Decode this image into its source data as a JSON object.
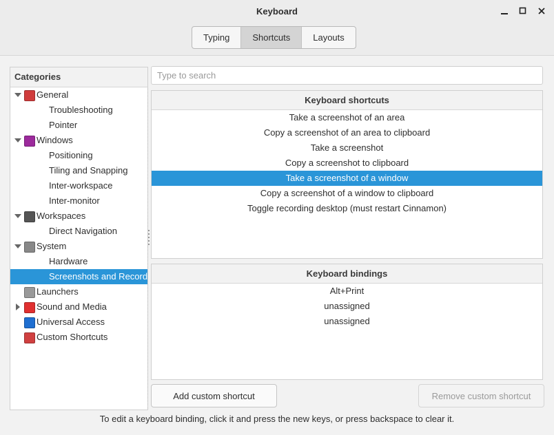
{
  "window": {
    "title": "Keyboard",
    "minimize_glyph": "–",
    "maximize_glyph": "□",
    "close_glyph": "×"
  },
  "tabs": [
    {
      "label": "Typing",
      "active": false
    },
    {
      "label": "Shortcuts",
      "active": true
    },
    {
      "label": "Layouts",
      "active": false
    }
  ],
  "categories": {
    "header": "Categories",
    "items": [
      {
        "label": "General",
        "level": 0,
        "expanded": true,
        "icon": "general-icon",
        "icon_color": "#d03c3c"
      },
      {
        "label": "Troubleshooting",
        "level": 1
      },
      {
        "label": "Pointer",
        "level": 1
      },
      {
        "label": "Windows",
        "level": 0,
        "expanded": true,
        "icon": "windows-icon",
        "icon_color": "#9c2a9c"
      },
      {
        "label": "Positioning",
        "level": 1
      },
      {
        "label": "Tiling and Snapping",
        "level": 1
      },
      {
        "label": "Inter-workspace",
        "level": 1
      },
      {
        "label": "Inter-monitor",
        "level": 1
      },
      {
        "label": "Workspaces",
        "level": 0,
        "expanded": true,
        "icon": "workspaces-icon",
        "icon_color": "#555555"
      },
      {
        "label": "Direct Navigation",
        "level": 1
      },
      {
        "label": "System",
        "level": 0,
        "expanded": true,
        "icon": "system-icon",
        "icon_color": "#888888"
      },
      {
        "label": "Hardware",
        "level": 1
      },
      {
        "label": "Screenshots and Recording",
        "level": 1,
        "selected": true
      },
      {
        "label": "Launchers",
        "level": 0,
        "icon": "launchers-icon",
        "icon_color": "#999999"
      },
      {
        "label": "Sound and Media",
        "level": 0,
        "expanded": false,
        "icon": "sound-media-icon",
        "icon_color": "#e03030"
      },
      {
        "label": "Universal Access",
        "level": 0,
        "icon": "universal-access-icon",
        "icon_color": "#1f6fd1"
      },
      {
        "label": "Custom Shortcuts",
        "level": 0,
        "icon": "custom-shortcuts-icon",
        "icon_color": "#d04040"
      }
    ]
  },
  "search": {
    "placeholder": "Type to search",
    "value": ""
  },
  "shortcuts": {
    "header": "Keyboard shortcuts",
    "items": [
      {
        "label": "Take a screenshot of an area"
      },
      {
        "label": "Copy a screenshot of an area to clipboard"
      },
      {
        "label": "Take a screenshot"
      },
      {
        "label": "Copy a screenshot to clipboard"
      },
      {
        "label": "Take a screenshot of a window",
        "selected": true
      },
      {
        "label": "Copy a screenshot of a window to clipboard"
      },
      {
        "label": "Toggle recording desktop (must restart Cinnamon)"
      }
    ]
  },
  "bindings": {
    "header": "Keyboard bindings",
    "items": [
      "Alt+Print",
      "unassigned",
      "unassigned"
    ]
  },
  "buttons": {
    "add": "Add custom shortcut",
    "remove": "Remove custom shortcut"
  },
  "hint": "To edit a keyboard binding, click it and press the new keys, or press backspace to clear it.",
  "colors": {
    "selection": "#2a95d8"
  }
}
